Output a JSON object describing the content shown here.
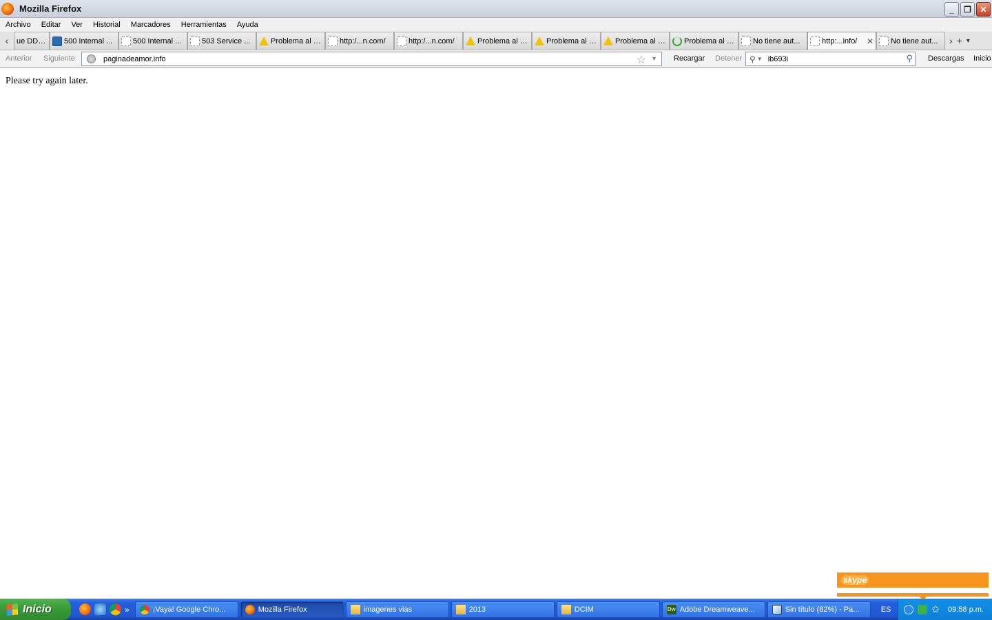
{
  "window": {
    "title": "Mozilla Firefox"
  },
  "menu": [
    "Archivo",
    "Editar",
    "Ver",
    "Historial",
    "Marcadores",
    "Herramientas",
    "Ayuda"
  ],
  "tabs": [
    {
      "label": "ue DDO...",
      "icon": "blank-page-icon"
    },
    {
      "label": "500 Internal ...",
      "icon": "site-favicon-icon"
    },
    {
      "label": "500 Internal ...",
      "icon": "blank-page-icon"
    },
    {
      "label": "503 Service ...",
      "icon": "blank-page-icon"
    },
    {
      "label": "Problema al c...",
      "icon": "warning-icon"
    },
    {
      "label": "http:/...n.com/",
      "icon": "blank-page-icon"
    },
    {
      "label": "http:/...n.com/",
      "icon": "blank-page-icon"
    },
    {
      "label": "Problema al c...",
      "icon": "warning-icon"
    },
    {
      "label": "Problema al c...",
      "icon": "warning-icon"
    },
    {
      "label": "Problema al c...",
      "icon": "warning-icon"
    },
    {
      "label": "Problema al c...",
      "icon": "loading-icon"
    },
    {
      "label": "No tiene aut...",
      "icon": "blank-page-icon"
    },
    {
      "label": "http:...info/",
      "icon": "blank-page-icon",
      "active": true
    },
    {
      "label": "No tiene aut...",
      "icon": "blank-page-icon"
    }
  ],
  "nav": {
    "back_label": "Anterior",
    "forward_label": "Siguiente",
    "url": "paginadeamor.info",
    "reload_label": "Recargar",
    "stop_label": "Detener",
    "search_query": "ib693i",
    "downloads_label": "Descargas",
    "home_label": "Inicio"
  },
  "content": {
    "message": "Please try again later."
  },
  "skype": {
    "logo": "skype"
  },
  "taskbar": {
    "start_label": "Inicio",
    "tasks": [
      {
        "label": "¡Vaya! Google Chro...",
        "icon": "chrome-icon"
      },
      {
        "label": "Mozilla Firefox",
        "icon": "firefox-icon",
        "active": true
      },
      {
        "label": "imagenes vias",
        "icon": "folder-icon"
      },
      {
        "label": "2013",
        "icon": "folder-icon"
      },
      {
        "label": "DCIM",
        "icon": "folder-icon"
      },
      {
        "label": "Adobe Dreamweave...",
        "icon": "dreamweaver-icon"
      },
      {
        "label": "Sin título (82%) - Pa...",
        "icon": "paint-icon"
      }
    ],
    "language": "ES",
    "clock": "09:58 p.m."
  }
}
